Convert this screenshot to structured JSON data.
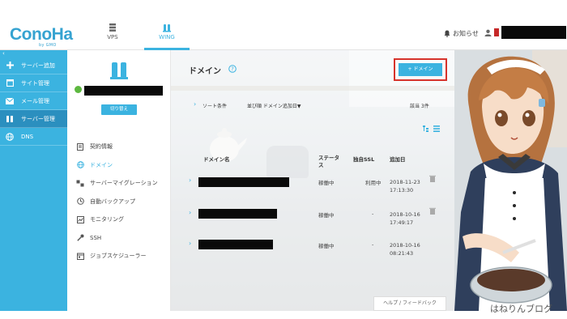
{
  "header": {
    "logo": "ConoHa",
    "logo_sub": "by GMO",
    "tabs": [
      {
        "label": "VPS",
        "icon": "server-grid-icon"
      },
      {
        "label": "WING",
        "icon": "wing-server-icon"
      }
    ],
    "notifications_label": "お知らせ"
  },
  "sidebar": {
    "collapse": "‹",
    "items": [
      {
        "label": "サーバー追加",
        "icon": "plus-icon"
      },
      {
        "label": "サイト管理",
        "icon": "window-icon"
      },
      {
        "label": "メール管理",
        "icon": "mail-icon"
      },
      {
        "label": "サーバー管理",
        "icon": "server-icon"
      },
      {
        "label": "DNS",
        "icon": "globe-icon"
      }
    ]
  },
  "subpanel": {
    "switch_button": "切り替え",
    "menu": [
      {
        "label": "契約情報",
        "icon": "contract-icon"
      },
      {
        "label": "ドメイン",
        "icon": "globe-icon"
      },
      {
        "label": "サーバーマイグレーション",
        "icon": "migration-icon"
      },
      {
        "label": "自動バックアップ",
        "icon": "backup-icon"
      },
      {
        "label": "モニタリング",
        "icon": "monitoring-icon"
      },
      {
        "label": "SSH",
        "icon": "key-icon"
      },
      {
        "label": "ジョブスケジューラー",
        "icon": "scheduler-icon"
      }
    ]
  },
  "main": {
    "title": "ドメイン",
    "add_button": "+ ドメイン",
    "sort": {
      "label": "ソート条件",
      "order": "並び順 ドメイン追加日▼",
      "count": "該当 3件"
    },
    "table": {
      "headers": [
        "ドメイン名",
        "ステータス",
        "独自SSL",
        "追加日"
      ],
      "rows": [
        {
          "status": "稼働中",
          "ssl": "利用中",
          "date": "2018-11-23",
          "time": "17:13:30"
        },
        {
          "status": "稼働中",
          "ssl": "-",
          "date": "2018-10-16",
          "time": "17:49:17"
        },
        {
          "status": "稼働中",
          "ssl": "-",
          "date": "2018-10-16",
          "time": "08:21:43"
        }
      ]
    },
    "help_feedback": "ヘルプ / フィードバック"
  },
  "watermark": "はねりんブログ",
  "colors": {
    "accent": "#3bb3e0",
    "sidebar_active": "#2b8fbf",
    "highlight": "#d6332b",
    "status_ok": "#5db840"
  }
}
